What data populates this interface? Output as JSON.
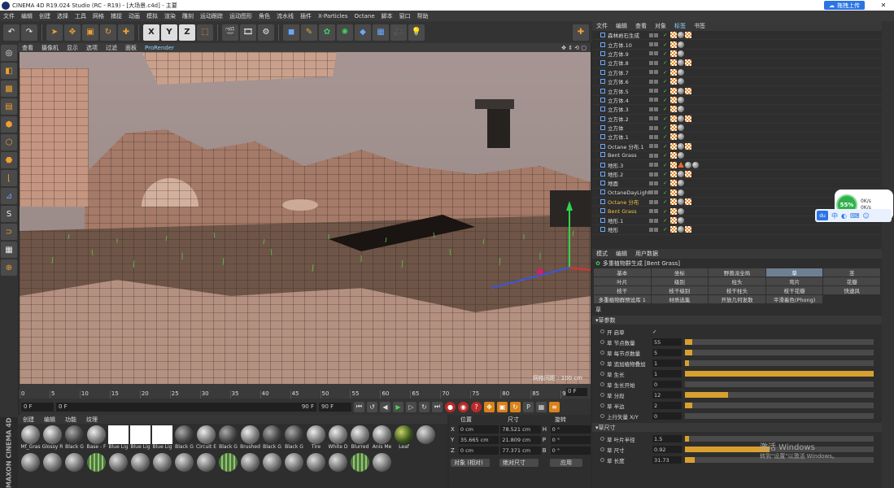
{
  "titlebar": {
    "title": "CINEMA 4D R19.024 Studio (RC - R19) - [大场景.c4d] - 主要",
    "baidu_upload": "拖拽上传",
    "min": "—",
    "max": "☐",
    "close": "✕"
  },
  "menu": [
    "文件",
    "编辑",
    "创建",
    "选择",
    "工具",
    "网格",
    "捕捉",
    "动画",
    "模拟",
    "渲染",
    "雕刻",
    "运动跟踪",
    "运动图形",
    "角色",
    "流水线",
    "插件",
    "X-Particles",
    "Octane",
    "脚本",
    "窗口",
    "帮助"
  ],
  "viewport": {
    "menu": [
      "查看",
      "摄像机",
      "显示",
      "选项",
      "过滤",
      "面板",
      "ProRender"
    ],
    "info": "网格间距 : 100 cm"
  },
  "timeline": {
    "ticks": [
      "0",
      "5",
      "10",
      "15",
      "20",
      "25",
      "30",
      "35",
      "40",
      "45",
      "50",
      "55",
      "60",
      "65",
      "70",
      "75",
      "80",
      "85",
      "90"
    ],
    "frame_box": "0 F"
  },
  "transport": {
    "start": "0 F",
    "current": "0 F",
    "end": "90 F",
    "end2": "90 F"
  },
  "material": {
    "menu": [
      "创建",
      "编辑",
      "功能",
      "纹理"
    ],
    "brand": "MAXON CINEMA 4D",
    "items": [
      "Mf_Gras",
      "Glossy R",
      "Black G",
      "Base - F",
      "Blue Lig",
      "Blue Lig",
      "Blue Lig",
      "Black G",
      "Circuit E",
      "Black G",
      "Brushed",
      "Black G",
      "Black G",
      "Tire",
      "White D",
      "Blurred",
      "Anis Me",
      "Leaf"
    ]
  },
  "coords": {
    "headers": [
      "位置",
      "尺寸",
      "旋转"
    ],
    "rows": [
      {
        "axis": "X",
        "pos": "0 cm",
        "size": "78.521 cm",
        "rot_axis": "H",
        "rot": "0 °"
      },
      {
        "axis": "Y",
        "pos": "35.665 cm",
        "size": "21.809 cm",
        "rot_axis": "P",
        "rot": "0 °"
      },
      {
        "axis": "Z",
        "pos": "0 cm",
        "size": "77.371 cm",
        "rot_axis": "B",
        "rot": "0 °"
      }
    ],
    "mode": "对象 (相对)",
    "size_mode": "绝对尺寸",
    "apply": "应用"
  },
  "objects": {
    "menu": [
      "文件",
      "编辑",
      "查看",
      "对象",
      "标签",
      "书签"
    ],
    "items": [
      {
        "name": "森林岩石生成"
      },
      {
        "name": "立方体.10"
      },
      {
        "name": "立方体.9"
      },
      {
        "name": "立方体.8"
      },
      {
        "name": "立方体.7"
      },
      {
        "name": "立方体.6"
      },
      {
        "name": "立方体.5"
      },
      {
        "name": "立方体.4"
      },
      {
        "name": "立方体.3"
      },
      {
        "name": "立方体.2"
      },
      {
        "name": "立方体"
      },
      {
        "name": "立方体.1"
      },
      {
        "name": "Octane 分布.1"
      },
      {
        "name": "Bent Grass"
      },
      {
        "name": "地形.3"
      },
      {
        "name": "地形.2"
      },
      {
        "name": "地面"
      },
      {
        "name": "OctaneDayLight"
      },
      {
        "name": "Octane 分布"
      },
      {
        "name": "Bent Grass"
      },
      {
        "name": "地形.1"
      },
      {
        "name": "地形"
      }
    ]
  },
  "attributes": {
    "menu": [
      "模式",
      "编辑",
      "用户数据"
    ],
    "title": "多重植物群生成 [Bent Grass]",
    "tabs": [
      "基本",
      "坐标",
      "野兽派全局",
      "草",
      "茎",
      "叶片",
      "级别",
      "柱头",
      "弯片",
      "花瓣",
      "枝干",
      "枝干级别",
      "枝干柱头",
      "枝干花瓣",
      "快速风",
      "多重植物群预设库 1",
      "材质选集",
      "开放几何发散",
      "平滑着色(Phong)"
    ],
    "section": "草",
    "subsection": "草参数",
    "subsection2": "草尺寸",
    "params": [
      {
        "label": "开 启草",
        "value": "✓",
        "fill": null
      },
      {
        "label": "草 节点数量",
        "value": "55",
        "fill": 0.04
      },
      {
        "label": "草 每节点数量",
        "value": "5",
        "fill": 0.04
      },
      {
        "label": "草 追加植物叠加",
        "value": "1",
        "fill": 0.02
      },
      {
        "label": "草 生长",
        "value": "1",
        "fill": 1.0
      },
      {
        "label": "草 生长开始",
        "value": "0",
        "fill": 0
      },
      {
        "label": "草 分段",
        "value": "12",
        "fill": 0.23
      },
      {
        "label": "草 半边",
        "value": "2",
        "fill": 0.04
      },
      {
        "label": "上行矢量 X/Y",
        "value": "0",
        "fill": 0
      }
    ],
    "params2": [
      {
        "label": "草 叶片半径",
        "value": "1.5",
        "fill": 0.02
      },
      {
        "label": "草 尺寸",
        "value": "0.92",
        "fill": 0.45
      },
      {
        "label": "草 长度",
        "value": "31.73",
        "fill": 0.05
      }
    ]
  },
  "watermark": {
    "line1": "激活 Windows",
    "line2": "转到\"设置\"以激活 Windows。"
  },
  "widget": {
    "percent": "55%",
    "up": "0K/s",
    "down": "0K/s",
    "du": "du",
    "lang": "中"
  }
}
